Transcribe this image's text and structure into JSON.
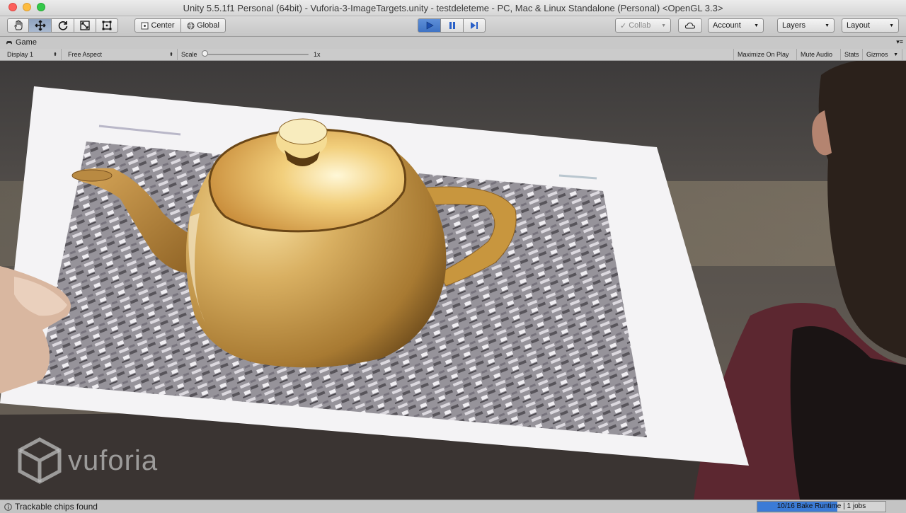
{
  "window": {
    "title": "Unity 5.5.1f1 Personal (64bit) - Vuforia-3-ImageTargets.unity - testdeleteme - PC, Mac & Linux Standalone (Personal) <OpenGL 3.3>"
  },
  "toolbar": {
    "tools": [
      "hand-icon",
      "move-icon",
      "rotate-icon",
      "scale-icon",
      "rect-icon"
    ],
    "active_tool": "move-icon",
    "pivot_label": "Center",
    "space_label": "Global",
    "playback": {
      "playing": true
    },
    "collab_label": "Collab",
    "account_label": "Account",
    "layers_label": "Layers",
    "layout_label": "Layout"
  },
  "game_view": {
    "tab_label": "Game",
    "display_label": "Display 1",
    "aspect_label": "Free Aspect",
    "scale_label": "Scale",
    "scale_value": "1x",
    "maximize_label": "Maximize On Play",
    "mute_label": "Mute Audio",
    "stats_label": "Stats",
    "gizmos_label": "Gizmos",
    "watermark": "vuforia"
  },
  "status": {
    "message": "Trackable chips found",
    "bake_label": "10/16 Bake Runtime",
    "jobs_label": "1 jobs",
    "bake_progress": 0.625
  },
  "colors": {
    "accent": "#3f73c4",
    "bake": "#3b7bd6"
  }
}
